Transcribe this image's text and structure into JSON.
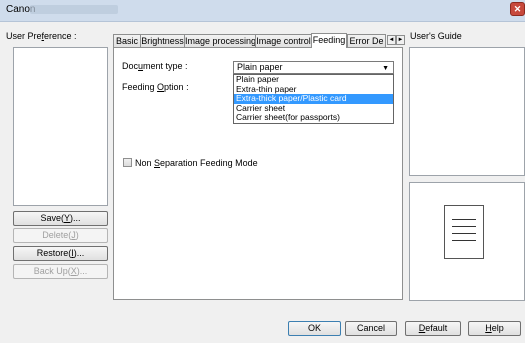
{
  "titlebar": {
    "title": "Canon",
    "close_glyph": "✕"
  },
  "left": {
    "user_preference_label": "User Preference :",
    "user_preference_accel": "f",
    "buttons": {
      "save": "Save(Y)...",
      "delete": "Delete(J)",
      "restore": "Restore(I)...",
      "backup": "Back Up(X)..."
    }
  },
  "tabs": [
    {
      "label": "Basic"
    },
    {
      "label": "Brightness"
    },
    {
      "label": "Image processing"
    },
    {
      "label": "Image control"
    },
    {
      "label": "Feeding"
    },
    {
      "label": "Error De"
    }
  ],
  "tab_scroll": {
    "left": "◄",
    "right": "►"
  },
  "feeding": {
    "document_type_label": "Document type :",
    "feeding_option_label": "Feeding Option :",
    "combo_value": "Plain paper",
    "combo_arrow": "▼",
    "dropdown_options": [
      "Plain paper",
      "Extra-thin paper",
      "Extra-thick paper/Plastic card",
      "Carrier sheet",
      "Carrier sheet(for passports)"
    ],
    "selected_index": 2,
    "non_separation_label": "Non Separation Feeding Mode",
    "non_separation_checked": false
  },
  "right": {
    "user_guide_label": "User's Guide"
  },
  "footer": {
    "ok": "OK",
    "cancel": "Cancel",
    "default": "Default",
    "help": "Help"
  },
  "colors": {
    "titlebar": "#cfdcec",
    "close": "#c7493c",
    "selection": "#3399ff",
    "window": "#f0f0f0"
  }
}
